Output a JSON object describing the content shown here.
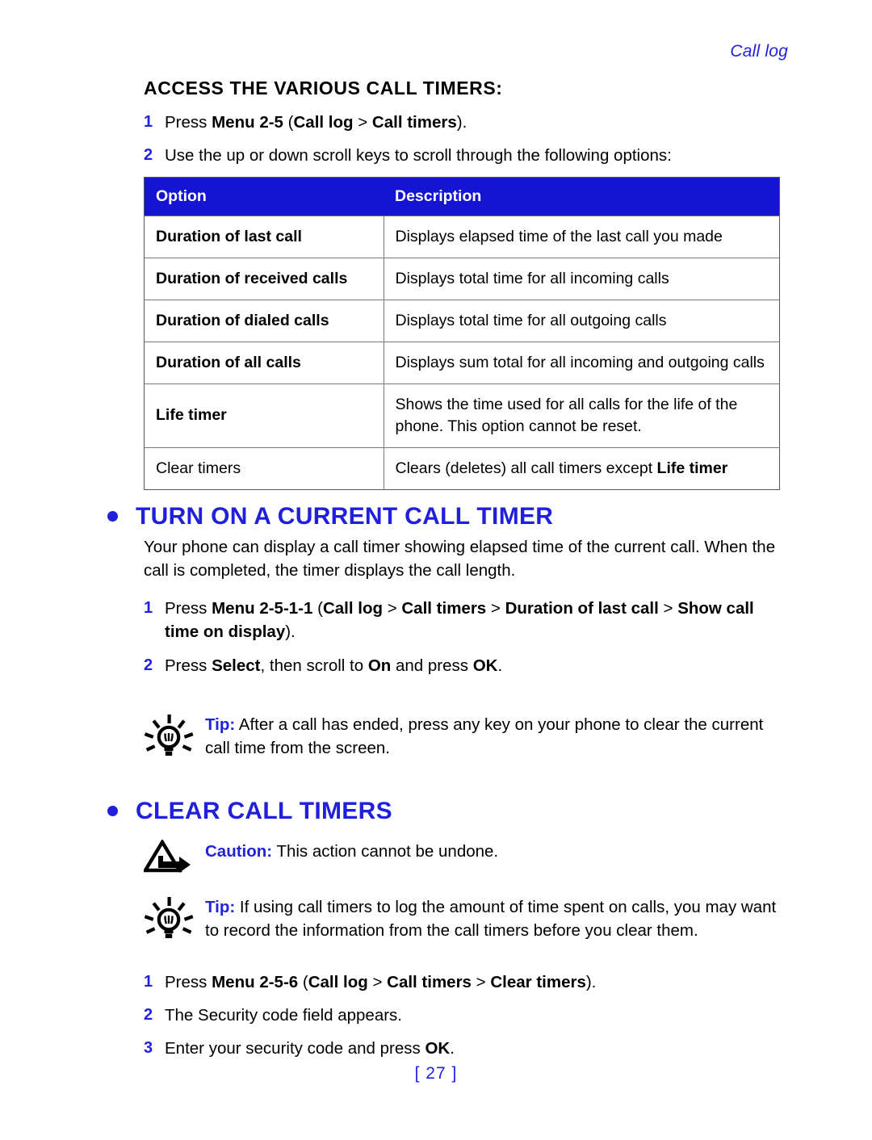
{
  "header": {
    "running_head": "Call log"
  },
  "section_access": {
    "heading": "ACCESS THE VARIOUS CALL TIMERS:",
    "steps": [
      {
        "num": "1",
        "parts": [
          {
            "t": "Press ",
            "b": false
          },
          {
            "t": "Menu 2-5",
            "b": true
          },
          {
            "t": " (",
            "b": false
          },
          {
            "t": "Call log",
            "b": true
          },
          {
            "t": " > ",
            "b": false
          },
          {
            "t": "Call timers",
            "b": true
          },
          {
            "t": ").",
            "b": false
          }
        ]
      },
      {
        "num": "2",
        "parts": [
          {
            "t": "Use the up or down scroll keys to scroll through the following options:",
            "b": false
          }
        ]
      }
    ]
  },
  "table": {
    "columns": [
      "Option",
      "Description"
    ],
    "rows": [
      {
        "option": "Duration of last call",
        "option_bold": true,
        "desc_parts": [
          {
            "t": "Displays elapsed time of the last call you made",
            "b": false
          }
        ]
      },
      {
        "option": "Duration of received calls",
        "option_bold": true,
        "desc_parts": [
          {
            "t": "Displays total time for all incoming calls",
            "b": false
          }
        ]
      },
      {
        "option": "Duration of dialed calls",
        "option_bold": true,
        "desc_parts": [
          {
            "t": "Displays total time for all outgoing calls",
            "b": false
          }
        ]
      },
      {
        "option": "Duration of all calls",
        "option_bold": true,
        "desc_parts": [
          {
            "t": "Displays sum total for all incoming and outgoing calls",
            "b": false
          }
        ]
      },
      {
        "option": "Life timer",
        "option_bold": true,
        "desc_parts": [
          {
            "t": "Shows the time used for all calls for the life of the phone. This option cannot be reset.",
            "b": false
          }
        ]
      },
      {
        "option": "Clear timers",
        "option_bold": false,
        "desc_parts": [
          {
            "t": "Clears (deletes) all call timers except ",
            "b": false
          },
          {
            "t": "Life timer",
            "b": true
          }
        ]
      }
    ]
  },
  "section_turn_on": {
    "heading": "TURN ON A CURRENT CALL TIMER",
    "paragraph": "Your phone can display a call timer showing elapsed time of the current call. When the call is completed, the timer displays the call length.",
    "steps": [
      {
        "num": "1",
        "parts": [
          {
            "t": "Press ",
            "b": false
          },
          {
            "t": "Menu 2-5-1-1",
            "b": true
          },
          {
            "t": " (",
            "b": false
          },
          {
            "t": "Call log",
            "b": true
          },
          {
            "t": " > ",
            "b": false
          },
          {
            "t": "Call timers",
            "b": true
          },
          {
            "t": " > ",
            "b": false
          },
          {
            "t": "Duration of last call",
            "b": true
          },
          {
            "t": " > ",
            "b": false
          },
          {
            "t": "Show call time on display",
            "b": true
          },
          {
            "t": ").",
            "b": false
          }
        ]
      },
      {
        "num": "2",
        "parts": [
          {
            "t": "Press ",
            "b": false
          },
          {
            "t": "Select",
            "b": true
          },
          {
            "t": ", then scroll to ",
            "b": false
          },
          {
            "t": "On",
            "b": true
          },
          {
            "t": " and press ",
            "b": false
          },
          {
            "t": "OK",
            "b": true
          },
          {
            "t": ".",
            "b": false
          }
        ]
      }
    ],
    "tip": {
      "icon": "lightbulb-icon",
      "label": "Tip:",
      "text": " After a call has ended, press any key on your phone to clear the current call time from the screen."
    }
  },
  "section_clear": {
    "heading": "CLEAR CALL TIMERS",
    "caution": {
      "icon": "caution-triangle-arrow-icon",
      "label": "Caution:",
      "text": " This action cannot be undone."
    },
    "tip": {
      "icon": "lightbulb-icon",
      "label": "Tip:",
      "text": " If using call timers to log the amount of time spent on calls, you may want to record the information from the call timers before you clear them."
    },
    "steps": [
      {
        "num": "1",
        "parts": [
          {
            "t": "Press ",
            "b": false
          },
          {
            "t": "Menu 2-5-6",
            "b": true
          },
          {
            "t": " (",
            "b": false
          },
          {
            "t": "Call log",
            "b": true
          },
          {
            "t": " > ",
            "b": false
          },
          {
            "t": "Call timers",
            "b": true
          },
          {
            "t": " > ",
            "b": false
          },
          {
            "t": "Clear timers",
            "b": true
          },
          {
            "t": ").",
            "b": false
          }
        ]
      },
      {
        "num": "2",
        "parts": [
          {
            "t": "The Security code field appears.",
            "b": false
          }
        ]
      },
      {
        "num": "3",
        "parts": [
          {
            "t": "Enter your security code and press ",
            "b": false
          },
          {
            "t": "OK",
            "b": true
          },
          {
            "t": ".",
            "b": false
          }
        ]
      }
    ]
  },
  "footer": {
    "page_number": "[ 27 ]"
  },
  "colors": {
    "accent_blue": "#2222dd",
    "heading_blue": "#1f1fdc",
    "table_header_blue": "#1414d2",
    "text_black": "#000000"
  }
}
